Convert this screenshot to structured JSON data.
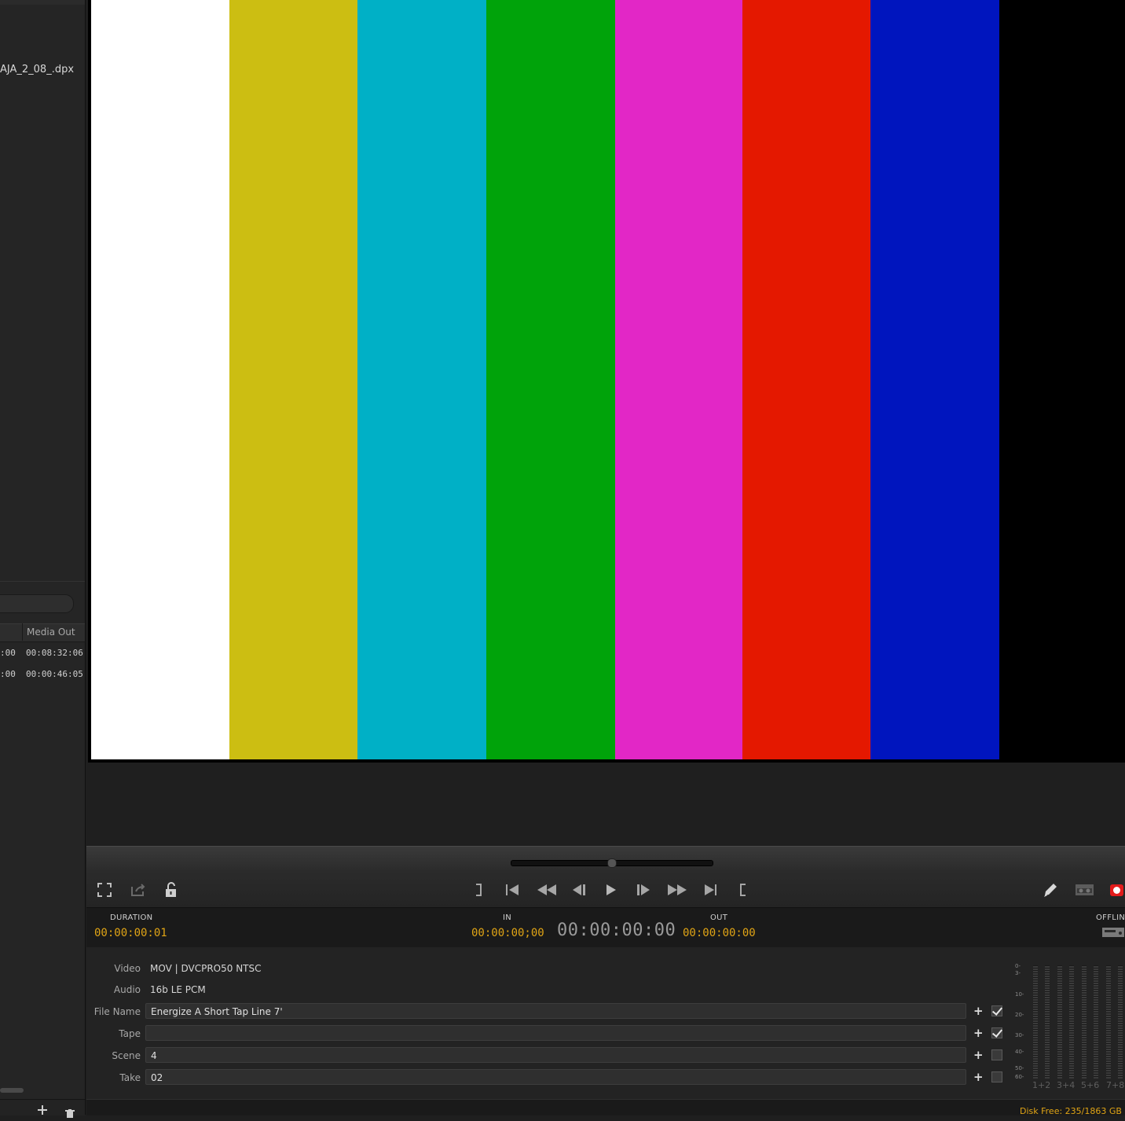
{
  "browser": {
    "selected_file": "AJA_2_08_.dpx",
    "table": {
      "column_media_out": "Media Out",
      "rows": [
        {
          "media_in_partial": ":00",
          "media_out": "00:08:32:06"
        },
        {
          "media_in_partial": ":00",
          "media_out": "00:00:46:05"
        }
      ]
    }
  },
  "color_bars": [
    "#ffffff",
    "#ccbe12",
    "#00b0c6",
    "#00a30a",
    "#e227c6",
    "#e41800",
    "#0015be"
  ],
  "timecode": {
    "duration_label": "DURATION",
    "duration_value": "00:00:00:01",
    "in_label": "IN",
    "in_value": "00:00:00;00",
    "current": "00:00:00:00",
    "out_label": "OUT",
    "out_value": "00:00:00:00",
    "offline_label": "OFFLINE"
  },
  "metadata": {
    "video_label": "Video",
    "video_value": "MOV  |  DVCPRO50 NTSC",
    "audio_label": "Audio",
    "audio_value": "16b LE PCM",
    "fields": [
      {
        "label": "File Name",
        "value": "Energize A Short Tap Line 7'",
        "checked": true
      },
      {
        "label": "Tape",
        "value": "",
        "checked": true
      },
      {
        "label": "Scene",
        "value": "4",
        "checked": false
      },
      {
        "label": "Take",
        "value": "02",
        "checked": false
      }
    ]
  },
  "meters": {
    "ticks": [
      "0-",
      "3-",
      "10-",
      "20-",
      "30-",
      "40-",
      "50-",
      "60-"
    ],
    "channels": [
      "1+2",
      "3+4",
      "5+6",
      "7+8"
    ]
  },
  "status": {
    "disk_free": "Disk Free: 235/1863 GB"
  },
  "icons": {
    "fullscreen": "fullscreen-icon",
    "export": "export-icon",
    "lock": "lock-open-icon",
    "mark_out": "mark-out-icon",
    "go_start": "go-to-start-icon",
    "rewind": "rewind-icon",
    "step_back": "step-back-icon",
    "play": "play-icon",
    "step_forward": "step-forward-icon",
    "fast_forward": "fast-forward-icon",
    "go_end": "go-to-end-icon",
    "mark_in": "mark-in-icon",
    "pencil": "pencil-icon",
    "tape": "tape-icon",
    "record": "record-icon"
  }
}
